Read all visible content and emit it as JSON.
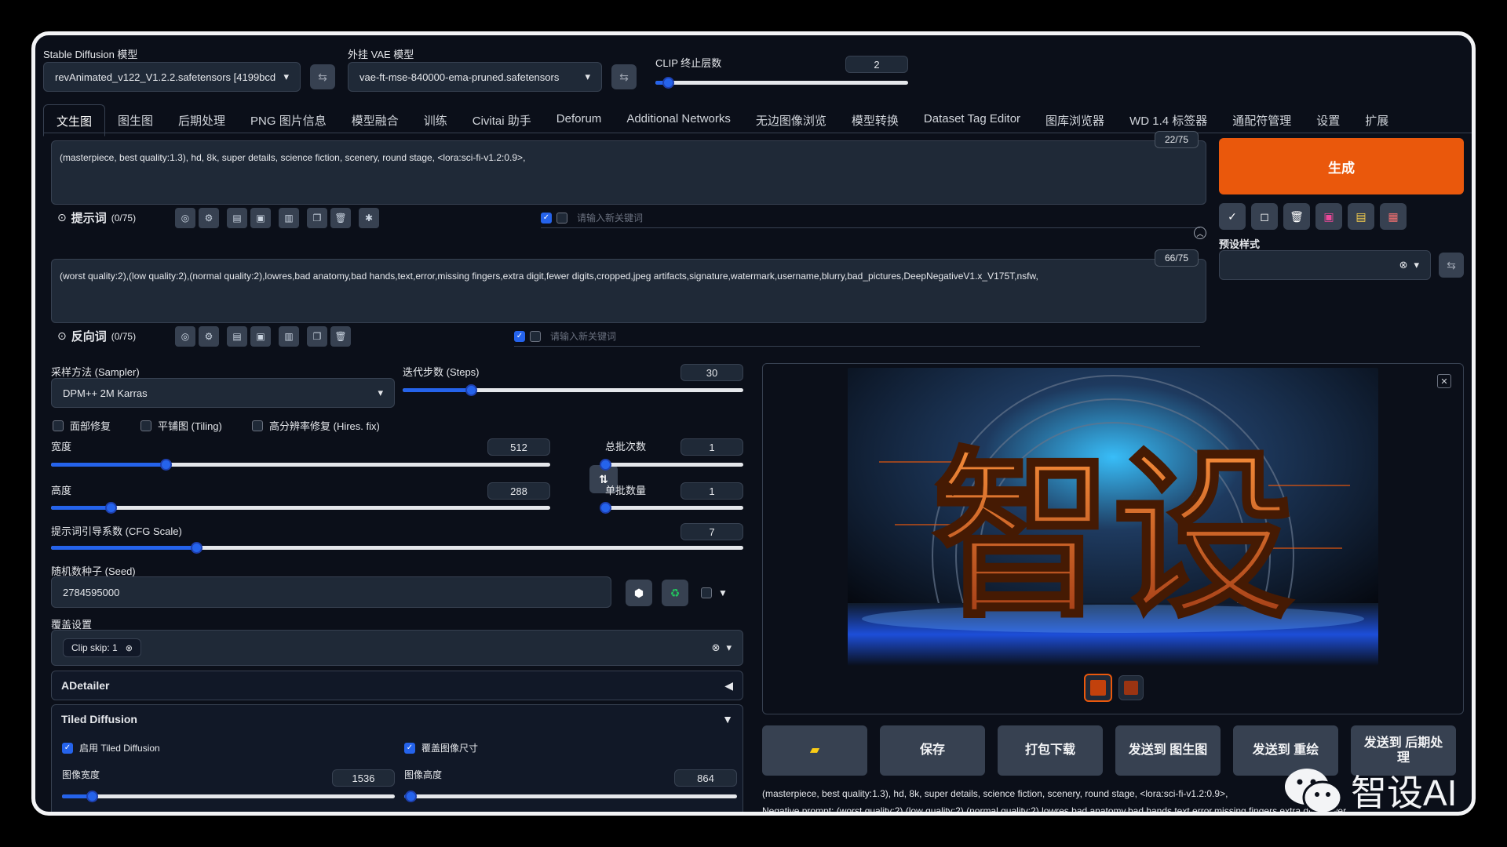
{
  "top": {
    "model_label": "Stable Diffusion 模型",
    "model_value": "revAnimated_v122_V1.2.2.safetensors [4199bcd",
    "vae_label": "外挂 VAE 模型",
    "vae_value": "vae-ft-mse-840000-ema-pruned.safetensors",
    "clip_label": "CLIP 终止层数",
    "clip_value": "2",
    "clip_fraction": 0.05
  },
  "tabs": [
    "文生图",
    "图生图",
    "后期处理",
    "PNG 图片信息",
    "模型融合",
    "训练",
    "Civitai 助手",
    "Deforum",
    "Additional Networks",
    "无边图像浏览",
    "模型转换",
    "Dataset Tag Editor",
    "图库浏览器",
    "WD 1.4 标签器",
    "通配符管理",
    "设置",
    "扩展"
  ],
  "prompt": {
    "text": "(masterpiece, best quality:1.3), hd, 8k, super details, science fiction, scenery, round stage, <lora:sci-fi-v1.2:0.9>,",
    "counter": "22/75",
    "section_label": "提示词",
    "section_count": "(0/75)",
    "keyword_placeholder": "请输入新关键词"
  },
  "negative": {
    "text": "(worst quality:2),(low quality:2),(normal quality:2),lowres,bad anatomy,bad hands,text,error,missing fingers,extra digit,fewer digits,cropped,jpeg artifacts,signature,watermark,username,blurry,bad_pictures,DeepNegativeV1.x_V175T,nsfw,",
    "counter": "66/75",
    "section_label": "反向词",
    "section_count": "(0/75)",
    "keyword_placeholder": "请输入新关键词"
  },
  "generate_label": "生成",
  "styles_label": "预设样式",
  "sampler": {
    "label": "采样方法 (Sampler)",
    "value": "DPM++ 2M Karras"
  },
  "steps": {
    "label": "迭代步数 (Steps)",
    "value": "30",
    "fraction": 0.2
  },
  "checks": {
    "face": "面部修复",
    "tiling": "平铺图 (Tiling)",
    "hires": "高分辨率修复 (Hires. fix)"
  },
  "width": {
    "label": "宽度",
    "value": "512",
    "fraction": 0.23
  },
  "height": {
    "label": "高度",
    "value": "288",
    "fraction": 0.12
  },
  "batch_count": {
    "label": "总批次数",
    "value": "1",
    "fraction": 0.0
  },
  "batch_size": {
    "label": "单批数量",
    "value": "1",
    "fraction": 0.0
  },
  "cfg": {
    "label": "提示词引导系数 (CFG Scale)",
    "value": "7",
    "fraction": 0.21
  },
  "seed": {
    "label": "随机数种子 (Seed)",
    "value": "2784595000"
  },
  "override": {
    "label": "覆盖设置",
    "chip": "Clip skip: 1"
  },
  "adetailer": {
    "label": "ADetailer"
  },
  "tiled": {
    "label": "Tiled Diffusion",
    "enable_label": "启用 Tiled Diffusion",
    "overwrite_label": "覆盖图像尺寸",
    "img_w_label": "图像宽度",
    "img_w_value": "1536",
    "img_w_fraction": 0.09,
    "img_h_label": "图像高度",
    "img_h_value": "864",
    "img_h_fraction": 0.02
  },
  "preview": {
    "artwork_text": "智设"
  },
  "actions": [
    "保存",
    "打包下载",
    "发送到 图生图",
    "发送到 重绘",
    "发送到 后期处理"
  ],
  "info_line1": "(masterpiece, best quality:1.3), hd, 8k, super details, science fiction, scenery, round stage, <lora:sci-fi-v1.2:0.9>,",
  "info_line2": "Negative prompt: (worst quality:2),(low quality:2),(normal quality:2),lowres,bad anatomy,bad hands,text,error,missing fingers,extra digit,fewer",
  "watermark": "智设AI",
  "colors": {
    "accent": "#ea580c",
    "slider": "#2563eb",
    "bg": "#0b0f19"
  }
}
